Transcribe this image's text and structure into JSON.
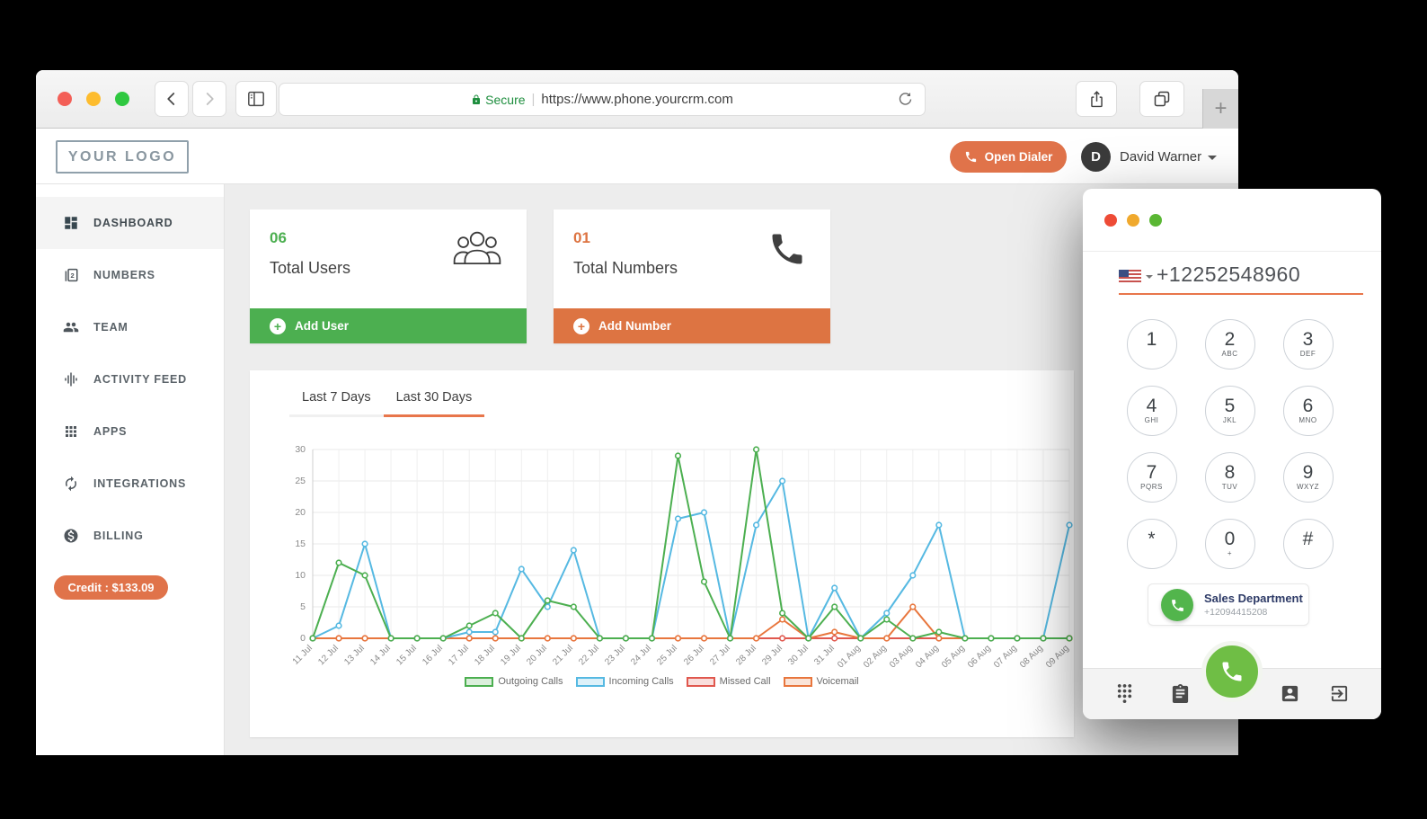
{
  "browser": {
    "secure_label": "Secure",
    "url": "https://www.phone.yourcrm.com"
  },
  "header": {
    "logo": "YOUR LOGO",
    "open_dialer_label": "Open Dialer",
    "user": {
      "initial": "D",
      "name": "David Warner"
    }
  },
  "sidebar": {
    "items": [
      {
        "label": "DASHBOARD",
        "icon": "dashboard-icon",
        "active": true
      },
      {
        "label": "NUMBERS",
        "icon": "numbers-icon",
        "active": false
      },
      {
        "label": "TEAM",
        "icon": "team-icon",
        "active": false
      },
      {
        "label": "ACTIVITY FEED",
        "icon": "activity-feed-icon",
        "active": false
      },
      {
        "label": "APPS",
        "icon": "apps-icon",
        "active": false
      },
      {
        "label": "INTEGRATIONS",
        "icon": "integrations-icon",
        "active": false
      },
      {
        "label": "BILLING",
        "icon": "billing-icon",
        "active": false
      }
    ],
    "credit_label": "Credit : $133.09"
  },
  "cards": [
    {
      "count": "06",
      "label": "Total Users",
      "action_label": "Add User",
      "accent": "#4caf50",
      "icon": "users-group-icon"
    },
    {
      "count": "01",
      "label": "Total Numbers",
      "action_label": "Add Number",
      "accent": "#dd7442",
      "icon": "phone-icon"
    }
  ],
  "chart_panel": {
    "tabs": [
      {
        "label": "Last 7 Days",
        "active": false
      },
      {
        "label": "Last 30 Days",
        "active": true
      }
    ]
  },
  "chart_data": {
    "type": "line",
    "x": [
      "11 Jul",
      "12 Jul",
      "13 Jul",
      "14 Jul",
      "15 Jul",
      "16 Jul",
      "17 Jul",
      "18 Jul",
      "19 Jul",
      "20 Jul",
      "21 Jul",
      "22 Jul",
      "23 Jul",
      "24 Jul",
      "25 Jul",
      "26 Jul",
      "27 Jul",
      "28 Jul",
      "29 Jul",
      "30 Jul",
      "31 Jul",
      "01 Aug",
      "02 Aug",
      "03 Aug",
      "04 Aug",
      "05 Aug",
      "06 Aug",
      "07 Aug",
      "08 Aug",
      "09 Aug"
    ],
    "series": [
      {
        "name": "Outgoing Calls",
        "color": "#4caf50",
        "values": [
          0,
          12,
          10,
          0,
          0,
          0,
          2,
          4,
          0,
          6,
          5,
          0,
          0,
          0,
          29,
          9,
          0,
          30,
          4,
          0,
          5,
          0,
          3,
          0,
          1,
          0,
          0,
          0,
          0,
          0
        ]
      },
      {
        "name": "Incoming Calls",
        "color": "#56b9e2",
        "values": [
          0,
          2,
          15,
          0,
          0,
          0,
          1,
          1,
          11,
          5,
          14,
          0,
          0,
          0,
          19,
          20,
          0,
          18,
          25,
          0,
          8,
          0,
          4,
          10,
          18,
          0,
          0,
          0,
          0,
          18
        ]
      },
      {
        "name": "Missed Call",
        "color": "#e0584e",
        "values": [
          0,
          0,
          0,
          0,
          0,
          0,
          0,
          0,
          0,
          0,
          0,
          0,
          0,
          0,
          0,
          0,
          0,
          0,
          0,
          0,
          0,
          0,
          0,
          0,
          0,
          0,
          0,
          0,
          0,
          0
        ]
      },
      {
        "name": "Voicemail",
        "color": "#e8763d",
        "values": [
          0,
          0,
          0,
          0,
          0,
          0,
          0,
          0,
          0,
          0,
          0,
          0,
          0,
          0,
          0,
          0,
          0,
          0,
          3,
          0,
          1,
          0,
          0,
          5,
          0,
          0,
          0,
          0,
          0,
          0
        ]
      }
    ],
    "ylim": [
      0,
      30
    ],
    "yticks": [
      0,
      5,
      10,
      15,
      20,
      25,
      30
    ],
    "grid": true,
    "legend_position": "bottom"
  },
  "dialer": {
    "number": "+12252548960",
    "flag": "us-flag-icon",
    "keys": [
      {
        "digit": "1",
        "letters": ""
      },
      {
        "digit": "2",
        "letters": "ABC"
      },
      {
        "digit": "3",
        "letters": "DEF"
      },
      {
        "digit": "4",
        "letters": "GHI"
      },
      {
        "digit": "5",
        "letters": "JKL"
      },
      {
        "digit": "6",
        "letters": "MNO"
      },
      {
        "digit": "7",
        "letters": "PQRS"
      },
      {
        "digit": "8",
        "letters": "TUV"
      },
      {
        "digit": "9",
        "letters": "WXYZ"
      },
      {
        "digit": "*",
        "letters": ""
      },
      {
        "digit": "0",
        "letters": "+"
      },
      {
        "digit": "#",
        "letters": ""
      }
    ],
    "contact": {
      "name": "Sales Department",
      "number": "+12094415208"
    },
    "toolbar_icons": [
      "dialpad-icon",
      "call-log-icon",
      "contacts-icon",
      "exit-icon"
    ],
    "call_button_color": "#6fbe45"
  }
}
